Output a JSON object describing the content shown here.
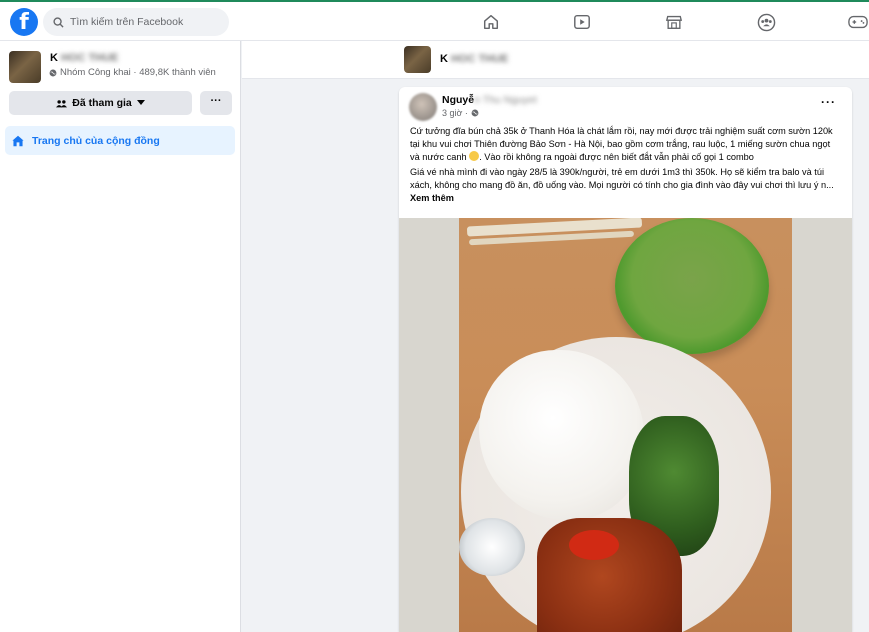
{
  "header": {
    "logo": "f",
    "search_placeholder": "Tìm kiếm trên Facebook",
    "nav_icons": [
      "home-icon",
      "video-icon",
      "marketplace-icon",
      "groups-icon",
      "gaming-icon"
    ]
  },
  "sidebar": {
    "group_name_visible": "K",
    "group_name_blurred": "HOC THUE",
    "group_meta": "Nhóm Công khai · 489,8K thành viên",
    "join_label": "Đã tham gia",
    "more_label": "···",
    "home_label": "Trang chủ của cộng đồng"
  },
  "subheader": {
    "group_name_visible": "K",
    "group_name_blurred": "HOC THUE"
  },
  "post": {
    "author_visible": "Nguyễ",
    "author_blurred": "n Thu Nguyet",
    "time": "3 giờ ·",
    "more": "···",
    "para1": "Cứ tưởng đĩa bún chả 35k ở Thanh Hóa là chát lắm rồi, nay mới được trải nghiệm suất cơm sườn 120k tại khu vui chơi Thiên đường Bảo Sơn - Hà Nội, bao gồm cơm trắng, rau luộc, 1 miếng sườn chua ngọt và nước canh",
    "para1_end": ". Vào rồi không ra ngoài được nên biết đắt vẫn phải cố gọi 1 combo",
    "para2": "Giá vé nhà mình đi vào ngày 28/5 là 390k/người, trẻ em dưới 1m3 thì 350k. Họ sẽ kiểm tra balo và túi xách, không cho mang đồ ăn, đồ uống vào. Mọi người có tính cho gia đình vào đây vui chơi thì lưu ý n...",
    "see_more": "Xem thêm"
  }
}
